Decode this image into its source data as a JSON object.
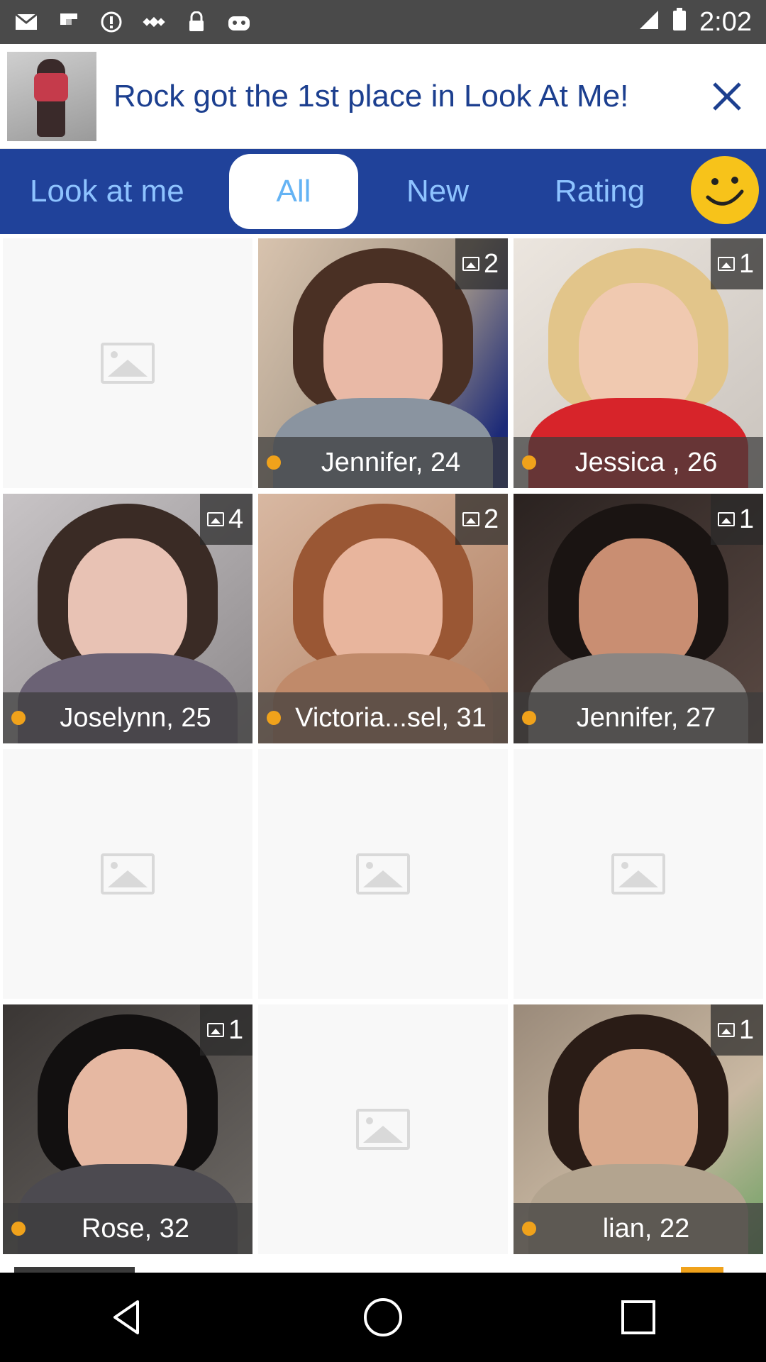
{
  "status_bar": {
    "time": "2:02",
    "icons_left": [
      "mail-icon",
      "flipboard-icon",
      "alert-icon",
      "satellite-icon",
      "lock-icon",
      "android-icon"
    ],
    "icons_right": [
      "signal-icon",
      "battery-icon"
    ]
  },
  "banner": {
    "text": "Rock got the 1st place in Look At Me!",
    "close_icon": "close-icon"
  },
  "tabs": {
    "items": [
      "Look at me",
      "All",
      "New",
      "Rating"
    ],
    "active": "All",
    "smiley_icon": "smiley-icon"
  },
  "colors": {
    "tab_bar": "#20429a",
    "tab_text": "#8ec3ff",
    "banner_text": "#1c3f8f",
    "online_dot": "#f0a21b"
  },
  "grid": [
    {
      "empty": true
    },
    {
      "empty": false,
      "name": "Jennifer, 24",
      "count": "2"
    },
    {
      "empty": false,
      "name": "Jessica , 26",
      "count": "1"
    },
    {
      "empty": false,
      "name": "Joselynn, 25",
      "count": "4"
    },
    {
      "empty": false,
      "name": "Victoria...sel, 31",
      "count": "2"
    },
    {
      "empty": false,
      "name": "Jennifer, 27",
      "count": "1"
    },
    {
      "empty": true
    },
    {
      "empty": true
    },
    {
      "empty": true
    },
    {
      "empty": false,
      "name": "Rose, 32",
      "count": "1"
    },
    {
      "empty": true
    },
    {
      "empty": false,
      "name": "lian, 22",
      "count": "1"
    }
  ],
  "nav": [
    "back-icon",
    "home-icon",
    "recents-icon"
  ]
}
